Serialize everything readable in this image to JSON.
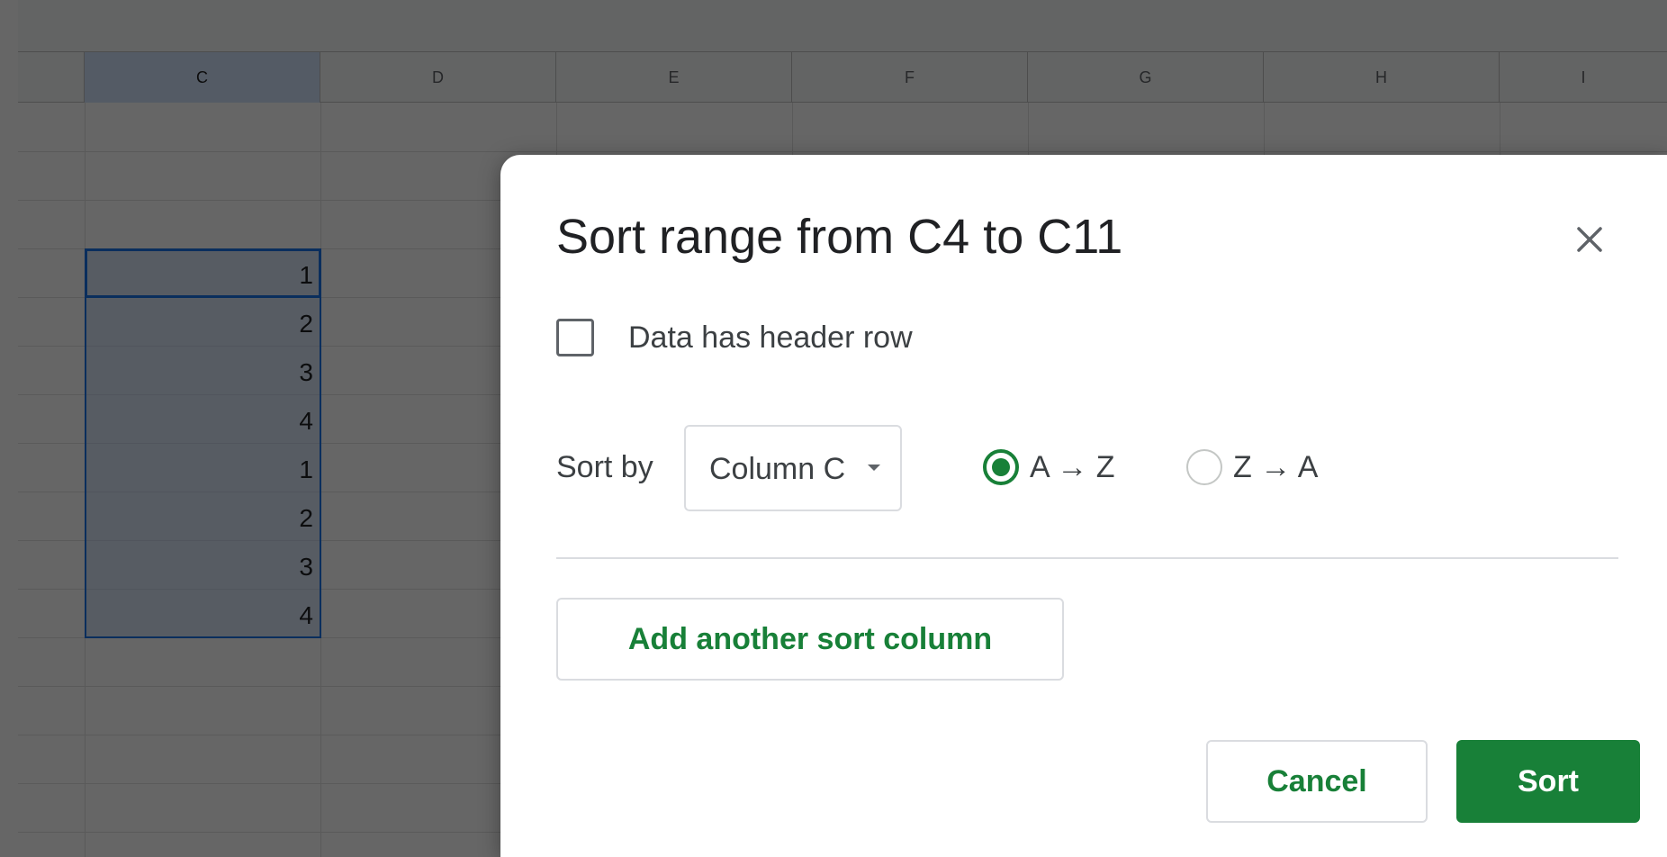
{
  "sheet": {
    "columns": [
      "C",
      "D",
      "E",
      "F",
      "G",
      "H",
      "I"
    ],
    "selected_column": "C",
    "cells": [
      "1",
      "2",
      "3",
      "4",
      "1",
      "2",
      "3",
      "4"
    ]
  },
  "dialog": {
    "title": "Sort range from C4 to C11",
    "header_checkbox": {
      "label": "Data has header row",
      "checked": false
    },
    "sort_by_label": "Sort by",
    "sort_column": "Column C",
    "order_options": [
      {
        "label": "A → Z",
        "selected": true
      },
      {
        "label": "Z → A",
        "selected": false
      }
    ],
    "add_sort_column_label": "Add another sort column",
    "cancel_label": "Cancel",
    "sort_label": "Sort"
  },
  "colors": {
    "accent": "#188038",
    "selection": "#1a73e8"
  }
}
